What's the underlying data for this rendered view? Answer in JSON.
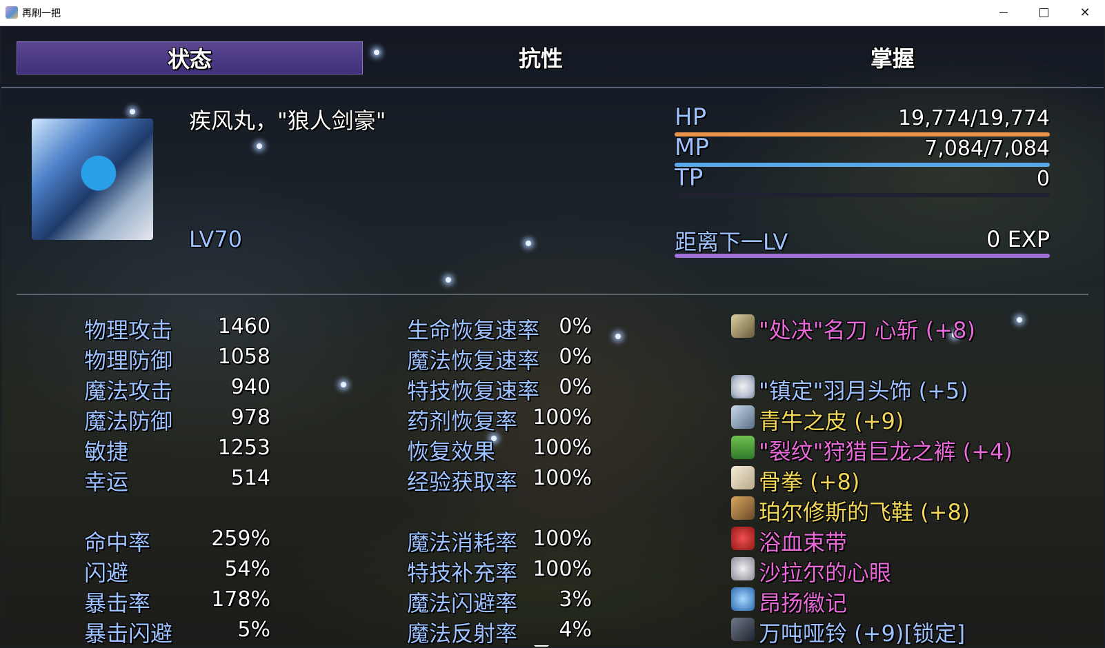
{
  "window": {
    "title": "再刷一把",
    "icon": "game-app-icon"
  },
  "tabs": [
    "状态",
    "抗性",
    "掌握"
  ],
  "actor": {
    "name": "疾风丸，\"狼人剑豪\"",
    "level": "LV70"
  },
  "gauges": {
    "hp": {
      "label": "HP",
      "value": "19,774/19,774",
      "fill": 1.0,
      "color": "#e8944a"
    },
    "mp": {
      "label": "MP",
      "value": "7,084/7,084",
      "fill": 1.0,
      "color": "#5aa8e8"
    },
    "tp": {
      "label": "TP",
      "value": "0",
      "fill": 0.0,
      "color": "#6a60b0"
    },
    "exp": {
      "label": "距离下一LV",
      "value": "0 EXP",
      "fill": 1.0,
      "color": "#a070d8"
    }
  },
  "params": [
    {
      "label": "物理攻击",
      "value": "1460"
    },
    {
      "label": "物理防御",
      "value": "1058"
    },
    {
      "label": "魔法攻击",
      "value": "940"
    },
    {
      "label": "魔法防御",
      "value": "978"
    },
    {
      "label": "敏捷",
      "value": "1253"
    },
    {
      "label": "幸运",
      "value": "514"
    }
  ],
  "xparams": [
    {
      "label": "命中率",
      "value": "259%"
    },
    {
      "label": "闪避",
      "value": "54%"
    },
    {
      "label": "暴击率",
      "value": "178%"
    },
    {
      "label": "暴击闪避",
      "value": "5%"
    }
  ],
  "sparams": [
    {
      "label": "生命恢复速率",
      "value": "0%"
    },
    {
      "label": "魔法恢复速率",
      "value": "0%"
    },
    {
      "label": "特技恢复速率",
      "value": "0%"
    },
    {
      "label": "药剂恢复率",
      "value": "100%"
    },
    {
      "label": "恢复效果",
      "value": "100%"
    },
    {
      "label": "经验获取率",
      "value": "100%"
    }
  ],
  "sparams2": [
    {
      "label": "魔法消耗率",
      "value": "100%"
    },
    {
      "label": "特技补充率",
      "value": "100%"
    },
    {
      "label": "魔法闪避率",
      "value": "3%"
    },
    {
      "label": "魔法反射率",
      "value": "4%"
    }
  ],
  "equipment": [
    {
      "name": "\"处决\"名刀 心斩 (+8)",
      "color": "#e86ad8",
      "icon": "katana-icon"
    },
    {
      "name": "",
      "color": "#ffffff",
      "icon": ""
    },
    {
      "name": "\"镇定\"羽月头饰 (+5)",
      "color": "#9ec2ff",
      "icon": "feather-headdress-icon"
    },
    {
      "name": "青牛之皮 (+9)",
      "color": "#f2d75a",
      "icon": "ox-hide-armor-icon"
    },
    {
      "name": "\"裂纹\"狩猎巨龙之裤 (+4)",
      "color": "#e86ad8",
      "icon": "green-pants-icon"
    },
    {
      "name": "骨拳 (+8)",
      "color": "#f2d75a",
      "icon": "bone-fist-icon"
    },
    {
      "name": "珀尔修斯的飞鞋 (+8)",
      "color": "#f2d75a",
      "icon": "winged-boots-icon"
    },
    {
      "name": "浴血束带",
      "color": "#e86ad8",
      "icon": "red-sash-icon"
    },
    {
      "name": "沙拉尔的心眼",
      "color": "#e86ad8",
      "icon": "eye-amulet-icon"
    },
    {
      "name": "昂扬徽记",
      "color": "#e86ad8",
      "icon": "blue-badge-icon"
    },
    {
      "name": "万吨哑铃 (+9)[锁定]",
      "color": "#9ec2ff",
      "icon": "dumbbell-icon"
    }
  ]
}
